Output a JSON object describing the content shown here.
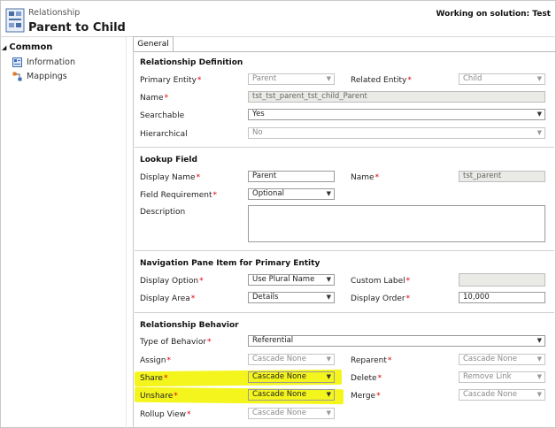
{
  "header": {
    "subtitle": "Relationship",
    "title": "Parent to Child",
    "solution_text": "Working on solution: Test"
  },
  "sidebar": {
    "section": "Common",
    "items": [
      {
        "label": "Information",
        "icon": "information-icon"
      },
      {
        "label": "Mappings",
        "icon": "mappings-icon"
      }
    ]
  },
  "tabs": [
    {
      "label": "General"
    }
  ],
  "relationship_definition": {
    "heading": "Relationship Definition",
    "primary_entity_label": "Primary Entity",
    "primary_entity_value": "Parent",
    "related_entity_label": "Related Entity",
    "related_entity_value": "Child",
    "name_label": "Name",
    "name_value": "tst_tst_parent_tst_child_Parent",
    "searchable_label": "Searchable",
    "searchable_value": "Yes",
    "hierarchical_label": "Hierarchical",
    "hierarchical_value": "No"
  },
  "lookup_field": {
    "heading": "Lookup Field",
    "display_name_label": "Display Name",
    "display_name_value": "Parent",
    "name_label": "Name",
    "name_value": "tst_parent",
    "field_requirement_label": "Field Requirement",
    "field_requirement_value": "Optional",
    "description_label": "Description",
    "description_value": ""
  },
  "navigation": {
    "heading": "Navigation Pane Item for Primary Entity",
    "display_option_label": "Display Option",
    "display_option_value": "Use Plural Name",
    "custom_label_label": "Custom Label",
    "custom_label_value": "",
    "display_area_label": "Display Area",
    "display_area_value": "Details",
    "display_order_label": "Display Order",
    "display_order_value": "10,000"
  },
  "behavior": {
    "heading": "Relationship Behavior",
    "type_label": "Type of Behavior",
    "type_value": "Referential",
    "assign_label": "Assign",
    "assign_value": "Cascade None",
    "reparent_label": "Reparent",
    "reparent_value": "Cascade None",
    "share_label": "Share",
    "share_value": "Cascade None",
    "delete_label": "Delete",
    "delete_value": "Remove Link",
    "unshare_label": "Unshare",
    "unshare_value": "Cascade None",
    "merge_label": "Merge",
    "merge_value": "Cascade None",
    "rollup_label": "Rollup View",
    "rollup_value": "Cascade None"
  },
  "required_marker": "*",
  "dropdown_arrow": "▼",
  "colors": {
    "highlight": "#f5f51e",
    "required": "#d00000"
  }
}
